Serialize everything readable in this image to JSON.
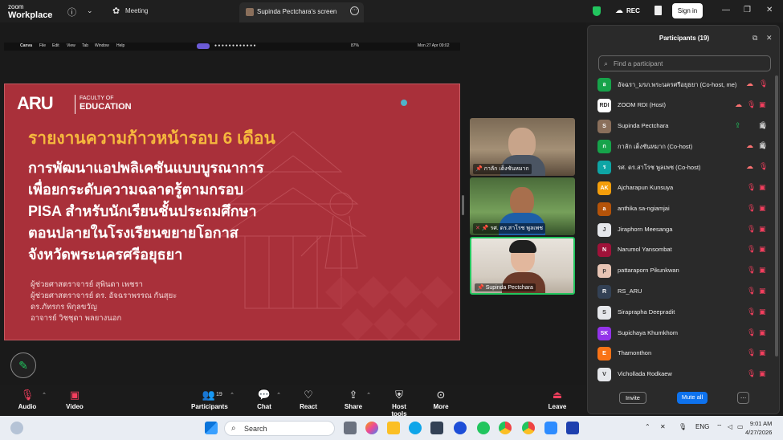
{
  "topbar": {
    "brand_top": "zoom",
    "brand_bottom": "Workplace",
    "meeting_label": "Meeting",
    "screen_tab_label": "Supinda Pectchara's screen",
    "rec_label": "REC",
    "signin_label": "Sign in"
  },
  "mac_bar": {
    "app": "Canva",
    "menus": [
      "File",
      "Edit",
      "View",
      "Tab",
      "Window",
      "Help"
    ],
    "battery": "87%",
    "datetime": "Mon 27 Apr 09:02"
  },
  "slide": {
    "logo": "ARU",
    "faculty_line1": "FACULTY OF",
    "faculty_line2": "EDUCATION",
    "title": "รายงานความก้าวหน้ารอบ 6 เดือน",
    "body": [
      "การพัฒนาแอปพลิเคชันแบบบูรณาการ",
      "เพื่อยกระดับความฉลาดรู้ตามกรอบ",
      "PISA สำหรับนักเรียนชั้นประถมศึกษา",
      "ตอนปลายในโรงเรียนขยายโอกาส",
      "จังหวัดพระนครศรีอยุธยา"
    ],
    "authors": [
      "ผู้ช่วยศาสตราจารย์ สุพินดา เพชรา",
      "ผู้ช่วยศาสตราจารย์ ดร. อัจฉราพรรณ กันสุยะ",
      "ดร.ภัทรกร พิกุลขวัญ",
      "อาจารย์ วิชชุดา พลยางนอก"
    ]
  },
  "videos": [
    {
      "name": "กาลัก เต็งชันหมาก",
      "muted": false
    },
    {
      "name": "รศ. ดร.สาโรช พูลเพช",
      "muted": true
    },
    {
      "name": "Supinda Pectchara",
      "muted": false
    }
  ],
  "toolbar": {
    "audio": "Audio",
    "video": "Video",
    "participants": "Participants",
    "participants_count": "19",
    "chat": "Chat",
    "react": "React",
    "share": "Share",
    "host_tools": "Host tools",
    "more": "More",
    "leave": "Leave"
  },
  "panel": {
    "title": "Participants (19)",
    "search_placeholder": "Find a participant",
    "invite_label": "Invite",
    "mute_all_label": "Mute all",
    "participants": [
      {
        "name": "อัจฉรา_มรภ.พระนครศรีอยุธยา (Co-host, me)",
        "initials": "อ",
        "color": "#16a34a",
        "cloud": true,
        "share": false,
        "muted": true,
        "video_off": false
      },
      {
        "name": "ZOOM RDI (Host)",
        "initials": "RDI",
        "color": "#ffffff",
        "cloud": true,
        "share": false,
        "muted": true,
        "video_off": true
      },
      {
        "name": "Supinda Pectchara",
        "initials": "S",
        "color": "#8a6f5b",
        "cloud": false,
        "share": true,
        "muted": false,
        "video_off": false
      },
      {
        "name": "กาลัก เต็งชันหมาก (Co-host)",
        "initials": "ก",
        "color": "#16a34a",
        "cloud": true,
        "share": false,
        "muted": false,
        "video_off": false
      },
      {
        "name": "รศ. ดร.สาโรช พูลเพช (Co-host)",
        "initials": "ร",
        "color": "#0ea5a5",
        "cloud": true,
        "share": false,
        "muted": true,
        "video_off": false
      },
      {
        "name": "Ajcharapun Kunsuya",
        "initials": "AK",
        "color": "#f59e0b",
        "cloud": false,
        "share": false,
        "muted": true,
        "video_off": true
      },
      {
        "name": "anthika sa-ngiamjai",
        "initials": "a",
        "color": "#b45309",
        "cloud": false,
        "share": false,
        "muted": true,
        "video_off": true
      },
      {
        "name": "Jiraphorn Meesanga",
        "initials": "J",
        "color": "#e5e7eb",
        "cloud": false,
        "share": false,
        "muted": true,
        "video_off": true
      },
      {
        "name": "Narumol Yansombat",
        "initials": "N",
        "color": "#9f1239",
        "cloud": false,
        "share": false,
        "muted": true,
        "video_off": true
      },
      {
        "name": "pattaraporn Pikunkwan",
        "initials": "p",
        "color": "#e7c4b4",
        "cloud": false,
        "share": false,
        "muted": true,
        "video_off": true
      },
      {
        "name": "RS_ARU",
        "initials": "R",
        "color": "#334155",
        "cloud": false,
        "share": false,
        "muted": true,
        "video_off": true
      },
      {
        "name": "Siraprapha Deepradit",
        "initials": "S",
        "color": "#e5e7eb",
        "cloud": false,
        "share": false,
        "muted": true,
        "video_off": true
      },
      {
        "name": "Supichaya Khumkhom",
        "initials": "SK",
        "color": "#9333ea",
        "cloud": false,
        "share": false,
        "muted": true,
        "video_off": true
      },
      {
        "name": "Thamonthon",
        "initials": "E",
        "color": "#f97316",
        "cloud": false,
        "share": false,
        "muted": true,
        "video_off": true
      },
      {
        "name": "Vichollada Rodkaew",
        "initials": "V",
        "color": "#e5e7eb",
        "cloud": false,
        "share": false,
        "muted": true,
        "video_off": true
      }
    ]
  },
  "taskbar": {
    "search_label": "Search",
    "lang": "ENG",
    "time": "9:01 AM",
    "date": "4/27/2026"
  },
  "colors": {
    "slide_bg": "#a9303a",
    "slide_title": "#f6b83d",
    "mute_red": "#f43f5e",
    "accent_blue": "#0e72ed",
    "active_green": "#22c55e"
  }
}
